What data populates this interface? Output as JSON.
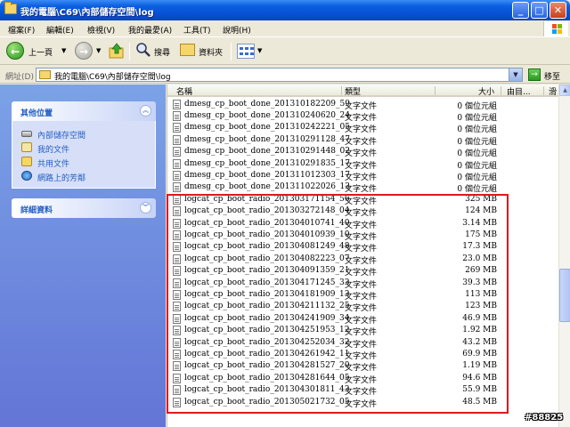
{
  "window": {
    "title": "我的電腦\\C69\\內部儲存空間\\log"
  },
  "menu": [
    "檔案(F)",
    "編輯(E)",
    "檢視(V)",
    "我的最愛(A)",
    "工具(T)",
    "說明(H)"
  ],
  "toolbar": {
    "back_label": "上一頁",
    "search_label": "搜尋",
    "folders_label": "資料夾"
  },
  "address": {
    "label": "網址(D)",
    "value": "我的電腦\\C69\\內部儲存空間\\log",
    "go_label": "移至"
  },
  "sidebar": {
    "other_places_title": "其他位置",
    "places": [
      "內部儲存空間",
      "我的文件",
      "共用文件",
      "網路上的芳鄰"
    ],
    "details_title": "詳細資料"
  },
  "columns": {
    "name": "名稱",
    "type": "類型",
    "size": "大小",
    "date": "由目...",
    "extra": "滑"
  },
  "files": [
    {
      "name": "dmesg_cp_boot_done_201310182209_59",
      "type": "文字文件",
      "size": "0 個位元組"
    },
    {
      "name": "dmesg_cp_boot_done_201310240620_24",
      "type": "文字文件",
      "size": "0 個位元組"
    },
    {
      "name": "dmesg_cp_boot_done_201310242221_05",
      "type": "文字文件",
      "size": "0 個位元組"
    },
    {
      "name": "dmesg_cp_boot_done_201310291128_47",
      "type": "文字文件",
      "size": "0 個位元組"
    },
    {
      "name": "dmesg_cp_boot_done_201310291448_02",
      "type": "文字文件",
      "size": "0 個位元組"
    },
    {
      "name": "dmesg_cp_boot_done_201310291835_17",
      "type": "文字文件",
      "size": "0 個位元組"
    },
    {
      "name": "dmesg_cp_boot_done_201311012303_17",
      "type": "文字文件",
      "size": "0 個位元組"
    },
    {
      "name": "dmesg_cp_boot_done_201311022026_13",
      "type": "文字文件",
      "size": "0 個位元組"
    },
    {
      "name": "logcat_cp_boot_radio_201303171154_56",
      "type": "文字文件",
      "size": "325 MB"
    },
    {
      "name": "logcat_cp_boot_radio_201303272148_04",
      "type": "文字文件",
      "size": "124 MB"
    },
    {
      "name": "logcat_cp_boot_radio_201304010741_40",
      "type": "文字文件",
      "size": "3.14 MB"
    },
    {
      "name": "logcat_cp_boot_radio_201304010939_10",
      "type": "文字文件",
      "size": "175 MB"
    },
    {
      "name": "logcat_cp_boot_radio_201304081249_48",
      "type": "文字文件",
      "size": "17.3 MB"
    },
    {
      "name": "logcat_cp_boot_radio_201304082223_07",
      "type": "文字文件",
      "size": "23.0 MB"
    },
    {
      "name": "logcat_cp_boot_radio_201304091359_21",
      "type": "文字文件",
      "size": "269 MB"
    },
    {
      "name": "logcat_cp_boot_radio_201304171245_33",
      "type": "文字文件",
      "size": "39.3 MB"
    },
    {
      "name": "logcat_cp_boot_radio_201304181909_13",
      "type": "文字文件",
      "size": "113 MB"
    },
    {
      "name": "logcat_cp_boot_radio_201304211132_25",
      "type": "文字文件",
      "size": "123 MB"
    },
    {
      "name": "logcat_cp_boot_radio_201304241909_34",
      "type": "文字文件",
      "size": "46.9 MB"
    },
    {
      "name": "logcat_cp_boot_radio_201304251953_12",
      "type": "文字文件",
      "size": "1.92 MB"
    },
    {
      "name": "logcat_cp_boot_radio_201304252034_32",
      "type": "文字文件",
      "size": "43.2 MB"
    },
    {
      "name": "logcat_cp_boot_radio_201304261942_11",
      "type": "文字文件",
      "size": "69.9 MB"
    },
    {
      "name": "logcat_cp_boot_radio_201304281527_20",
      "type": "文字文件",
      "size": "1.19 MB"
    },
    {
      "name": "logcat_cp_boot_radio_201304281644_05",
      "type": "文字文件",
      "size": "94.6 MB"
    },
    {
      "name": "logcat_cp_boot_radio_201304301811_43",
      "type": "文字文件",
      "size": "55.9 MB"
    },
    {
      "name": "logcat_cp_boot_radio_201305021732_05",
      "type": "文字文件",
      "size": "48.5 MB"
    }
  ],
  "watermark": "#88825"
}
